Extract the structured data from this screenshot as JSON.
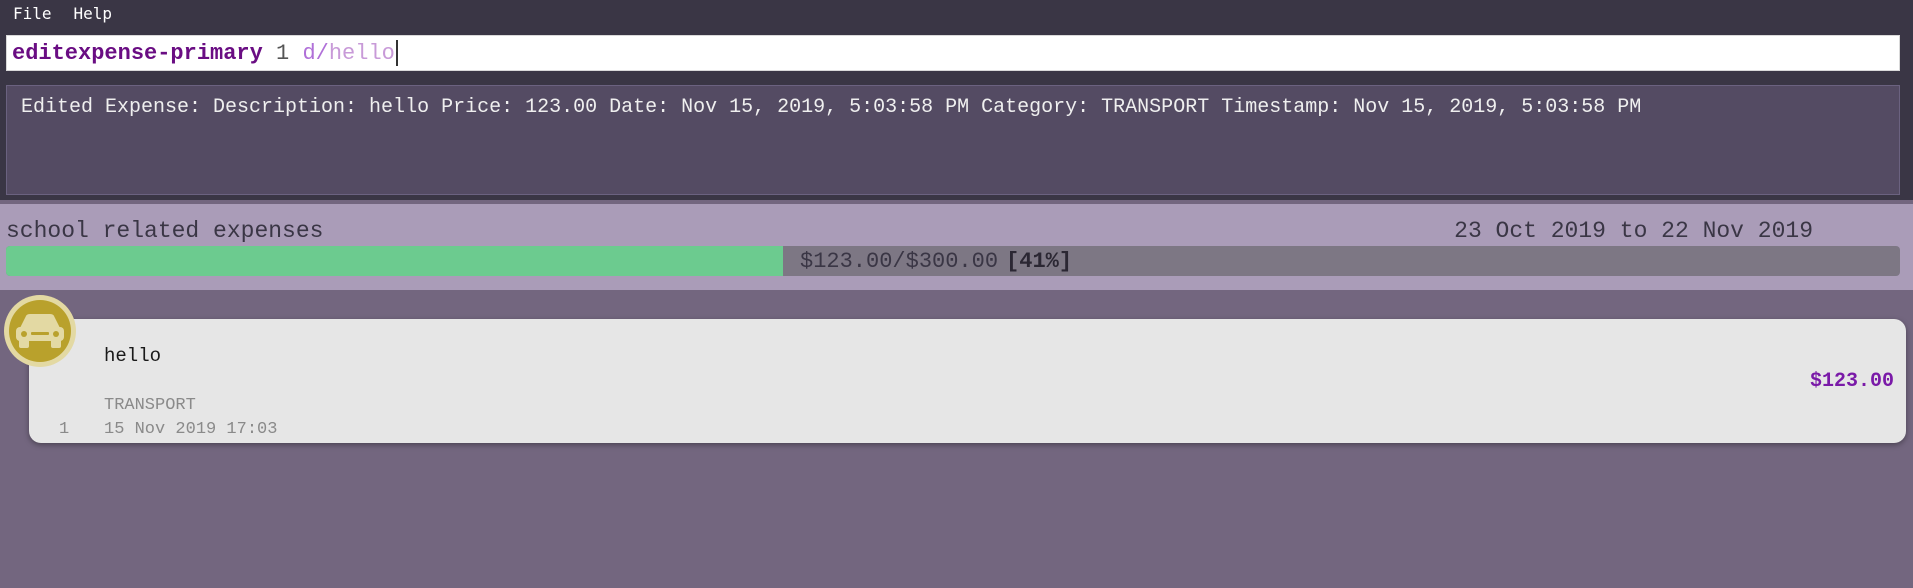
{
  "menu": {
    "file": "File",
    "help": "Help"
  },
  "command": {
    "word": "editexpense-primary",
    "index": "1",
    "prefix": "d/",
    "argument": "hello"
  },
  "result": {
    "message": "Edited Expense: Description: hello Price: 123.00 Date: Nov 15, 2019, 5:03:58 PM Category: TRANSPORT Timestamp: Nov 15, 2019, 5:03:58 PM"
  },
  "budget": {
    "name": "school related expenses",
    "period": "23 Oct 2019 to 22 Nov 2019",
    "amount_text": "$123.00/$300.00",
    "percent_text": "[41%]",
    "progress_fraction": 0.41,
    "fill_color": "#6ccb8f"
  },
  "expenses": [
    {
      "index": "1",
      "description": "hello",
      "category": "TRANSPORT",
      "date": "15 Nov 2019 17:03",
      "price": "$123.00",
      "icon": "car-icon"
    }
  ],
  "colors": {
    "command_word": "#6a0d83",
    "price": "#7a1aa8",
    "background": "#73667f",
    "budget_panel": "#aa9cb8"
  }
}
